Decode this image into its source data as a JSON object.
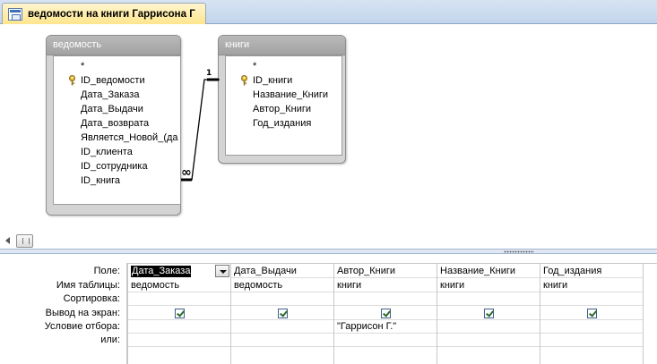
{
  "tab": {
    "title": "ведомости на книги Гаррисона Г"
  },
  "tables": [
    {
      "title": "ведомость",
      "fields": [
        {
          "name": "*",
          "key": false
        },
        {
          "name": "ID_ведомости",
          "key": true
        },
        {
          "name": "Дата_Заказа",
          "key": false
        },
        {
          "name": "Дата_Выдачи",
          "key": false
        },
        {
          "name": "Дата_возврата",
          "key": false
        },
        {
          "name": "Является_Новой_(да",
          "key": false
        },
        {
          "name": "ID_клиента",
          "key": false
        },
        {
          "name": "ID_сотрудника",
          "key": false
        },
        {
          "name": "ID_книга",
          "key": false
        }
      ]
    },
    {
      "title": "книги",
      "fields": [
        {
          "name": "*",
          "key": false
        },
        {
          "name": "ID_книги",
          "key": true
        },
        {
          "name": "Название_Книги",
          "key": false
        },
        {
          "name": "Автор_Книги",
          "key": false
        },
        {
          "name": "Год_издания",
          "key": false
        }
      ]
    }
  ],
  "relationship": {
    "one_label": "1",
    "many_label": "∞"
  },
  "grid": {
    "row_labels": {
      "field": "Поле:",
      "table": "Имя таблицы:",
      "sort": "Сортировка:",
      "show": "Вывод на экран:",
      "criteria": "Условие отбора:",
      "or": "или:"
    },
    "columns": [
      {
        "field": "Дата_Заказа",
        "table": "ведомость",
        "sort": "",
        "show": true,
        "criteria": "",
        "or": ""
      },
      {
        "field": "Дата_Выдачи",
        "table": "ведомость",
        "sort": "",
        "show": true,
        "criteria": "",
        "or": ""
      },
      {
        "field": "Автор_Книги",
        "table": "книги",
        "sort": "",
        "show": true,
        "criteria": "\"Гаррисон Г.\"",
        "or": ""
      },
      {
        "field": "Название_Книги",
        "table": "книги",
        "sort": "",
        "show": true,
        "criteria": "",
        "or": ""
      },
      {
        "field": "Год_издания",
        "table": "книги",
        "sort": "",
        "show": true,
        "criteria": "",
        "or": ""
      }
    ]
  },
  "icons": {
    "key": "key-icon",
    "tab": "query-icon",
    "checkbox": "checkmark-icon",
    "dropdown": "chevron-down-icon"
  },
  "colors": {
    "tab_bg": "#ffe48a",
    "table_title_bg": "#a9a9a9",
    "relationship_line": "#000000"
  }
}
